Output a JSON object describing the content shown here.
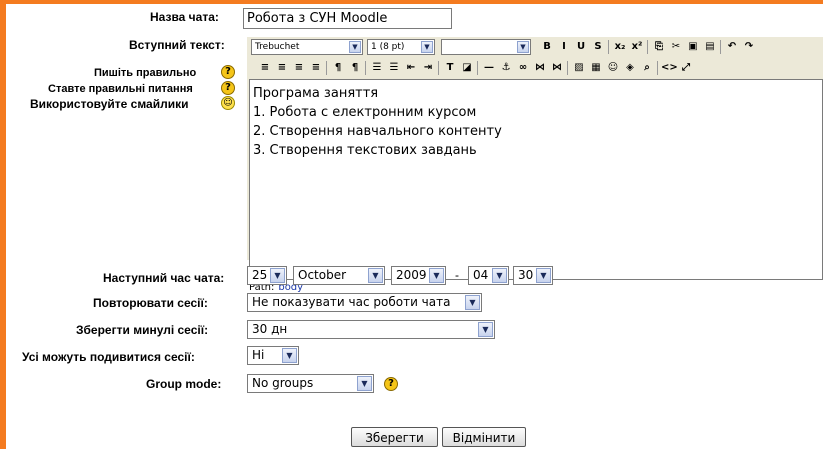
{
  "form": {
    "chat_name_label": "Назва чата:",
    "chat_name_value": "Робота з СУН Moodle",
    "intro_label": "Вступний текст:",
    "hints": {
      "write_correctly": "Пишіть правильно",
      "ask_questions": "Ставте правильні питання",
      "use_smileys": "Використовуйте смайлики"
    },
    "next_time_label": "Наступний час чата:",
    "day": "25",
    "month": "October",
    "year": "2009",
    "date_time_separator": "-",
    "hour": "04",
    "minute": "30",
    "repeat_label": "Повторювати сесії:",
    "repeat_value": "Не показувати час роботи чата",
    "keep_label": "Зберегти минулі сесії:",
    "keep_value": "30 дн",
    "view_label": "Усі можуть подивитися сесії:",
    "view_value": "Ні",
    "group_mode_label": "Group mode:",
    "group_mode_value": "No groups",
    "save_button": "Зберегти",
    "cancel_button": "Відмінити"
  },
  "editor": {
    "font_value": "Trebuchet",
    "size_value": "1 (8 pt)",
    "style_value": "",
    "content_lines": [
      "Програма заняття",
      "1. Робота с електронним курсом",
      "2. Створення навчального контенту",
      "3. Створення текстових завдань"
    ],
    "path_label": "Path:",
    "path_value": "body",
    "toolbar_row1": [
      {
        "name": "bold-button",
        "glyph": "B"
      },
      {
        "name": "italic-button",
        "glyph": "I"
      },
      {
        "name": "underline-button",
        "glyph": "U"
      },
      {
        "name": "strikethrough-button",
        "glyph": "S"
      },
      {
        "name": "subscript-button",
        "glyph": "x₂"
      },
      {
        "name": "superscript-button",
        "glyph": "x²"
      },
      {
        "name": "copy-button",
        "glyph": "⎘"
      },
      {
        "name": "cut-button",
        "glyph": "✂"
      },
      {
        "name": "paste-button",
        "glyph": "▣"
      },
      {
        "name": "paste-word-button",
        "glyph": "▤"
      },
      {
        "name": "undo-button",
        "glyph": "↶"
      },
      {
        "name": "redo-button",
        "glyph": "↷"
      }
    ],
    "toolbar_row2": [
      {
        "name": "align-left-button",
        "glyph": "≡"
      },
      {
        "name": "align-center-button",
        "glyph": "≡"
      },
      {
        "name": "align-right-button",
        "glyph": "≡"
      },
      {
        "name": "justify-button",
        "glyph": "≡"
      },
      {
        "name": "ltr-button",
        "glyph": "¶"
      },
      {
        "name": "rtl-button",
        "glyph": "¶"
      },
      {
        "name": "ordered-list-button",
        "glyph": "☰"
      },
      {
        "name": "unordered-list-button",
        "glyph": "☰"
      },
      {
        "name": "outdent-button",
        "glyph": "⇤"
      },
      {
        "name": "indent-button",
        "glyph": "⇥"
      },
      {
        "name": "text-color-button",
        "glyph": "T"
      },
      {
        "name": "bg-color-button",
        "glyph": "◪"
      },
      {
        "name": "horizontal-rule-button",
        "glyph": "—"
      },
      {
        "name": "anchor-button",
        "glyph": "⚓"
      },
      {
        "name": "link-button",
        "glyph": "∞"
      },
      {
        "name": "unlink-button",
        "glyph": "⋈"
      },
      {
        "name": "nolink-button",
        "glyph": "⋈"
      },
      {
        "name": "image-button",
        "glyph": "▨"
      },
      {
        "name": "table-button",
        "glyph": "▦"
      },
      {
        "name": "smiley-button",
        "glyph": "☺"
      },
      {
        "name": "special-char-button",
        "glyph": "◈"
      },
      {
        "name": "search-replace-button",
        "glyph": "⌕"
      },
      {
        "name": "html-source-button",
        "glyph": "<>"
      },
      {
        "name": "fullscreen-button",
        "glyph": "⤢"
      }
    ]
  },
  "colors": {
    "frame": "#f47b20",
    "editor_bg": "#ece9d8",
    "help_icon": "#f5c518"
  }
}
